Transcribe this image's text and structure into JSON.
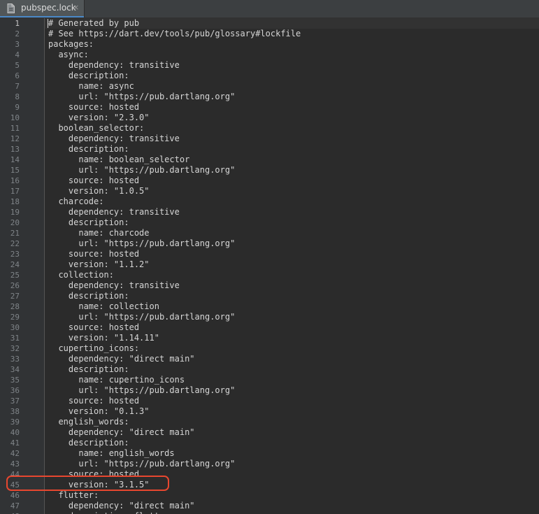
{
  "tab": {
    "label": "pubspec.lock",
    "icon": "file-icon",
    "close_glyph": "×"
  },
  "editor": {
    "current_line": 1,
    "lines": [
      "# Generated by pub",
      "# See https://dart.dev/tools/pub/glossary#lockfile",
      "packages:",
      "  async:",
      "    dependency: transitive",
      "    description:",
      "      name: async",
      "      url: \"https://pub.dartlang.org\"",
      "    source: hosted",
      "    version: \"2.3.0\"",
      "  boolean_selector:",
      "    dependency: transitive",
      "    description:",
      "      name: boolean_selector",
      "      url: \"https://pub.dartlang.org\"",
      "    source: hosted",
      "    version: \"1.0.5\"",
      "  charcode:",
      "    dependency: transitive",
      "    description:",
      "      name: charcode",
      "      url: \"https://pub.dartlang.org\"",
      "    source: hosted",
      "    version: \"1.1.2\"",
      "  collection:",
      "    dependency: transitive",
      "    description:",
      "      name: collection",
      "      url: \"https://pub.dartlang.org\"",
      "    source: hosted",
      "    version: \"1.14.11\"",
      "  cupertino_icons:",
      "    dependency: \"direct main\"",
      "    description:",
      "      name: cupertino_icons",
      "      url: \"https://pub.dartlang.org\"",
      "    source: hosted",
      "    version: \"0.1.3\"",
      "  english_words:",
      "    dependency: \"direct main\"",
      "    description:",
      "      name: english_words",
      "      url: \"https://pub.dartlang.org\"",
      "    source: hosted",
      "    version: \"3.1.5\"",
      "  flutter:",
      "    dependency: \"direct main\"",
      "    description: flutter"
    ]
  },
  "highlight": {
    "line": 45,
    "color": "#e8472f"
  },
  "colors": {
    "background": "#2b2b2b",
    "gutter": "#313335",
    "text": "#d6d6d6",
    "line_number": "#7f8488",
    "tab_active": "#515658",
    "accent": "#4a88c7"
  }
}
